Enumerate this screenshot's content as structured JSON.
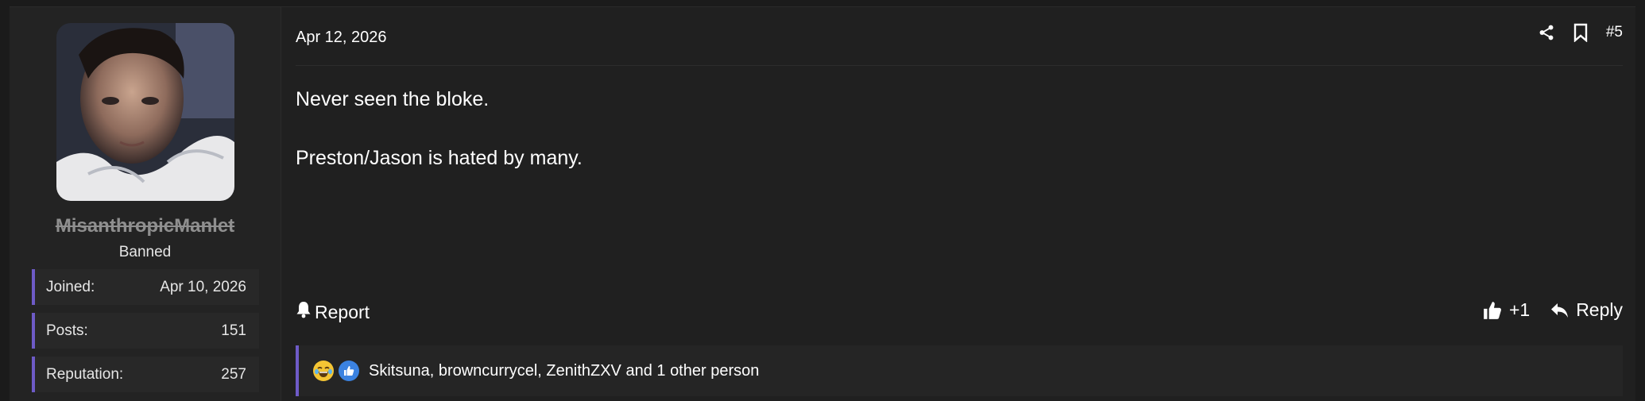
{
  "post": {
    "date": "Apr 12, 2026",
    "number": "#5",
    "message_lines": [
      "Never seen the bloke.",
      "Preston/Jason is hated by many."
    ],
    "icons": {
      "share": "share-icon",
      "bookmark": "bookmark-icon",
      "report": "bell-icon",
      "like": "thumbs-up-icon",
      "reply": "reply-arrow-icon"
    }
  },
  "user": {
    "name": "MisanthropicManlet",
    "title": "Banned",
    "stats": [
      {
        "label": "Joined:",
        "value": "Apr 10, 2026"
      },
      {
        "label": "Posts:",
        "value": "151"
      },
      {
        "label": "Reputation:",
        "value": "257"
      }
    ]
  },
  "actions": {
    "report": "Report",
    "like_count": "+1",
    "reply": "Reply"
  },
  "reactions": {
    "icons": [
      "crying-laughing-emoji-icon",
      "like-icon"
    ],
    "text": "Skitsuna, browncurrycel, ZenithZXV and 1 other person"
  },
  "colors": {
    "accent": "#6e5bc7",
    "background": "#202020",
    "sidebar": "#232323"
  }
}
